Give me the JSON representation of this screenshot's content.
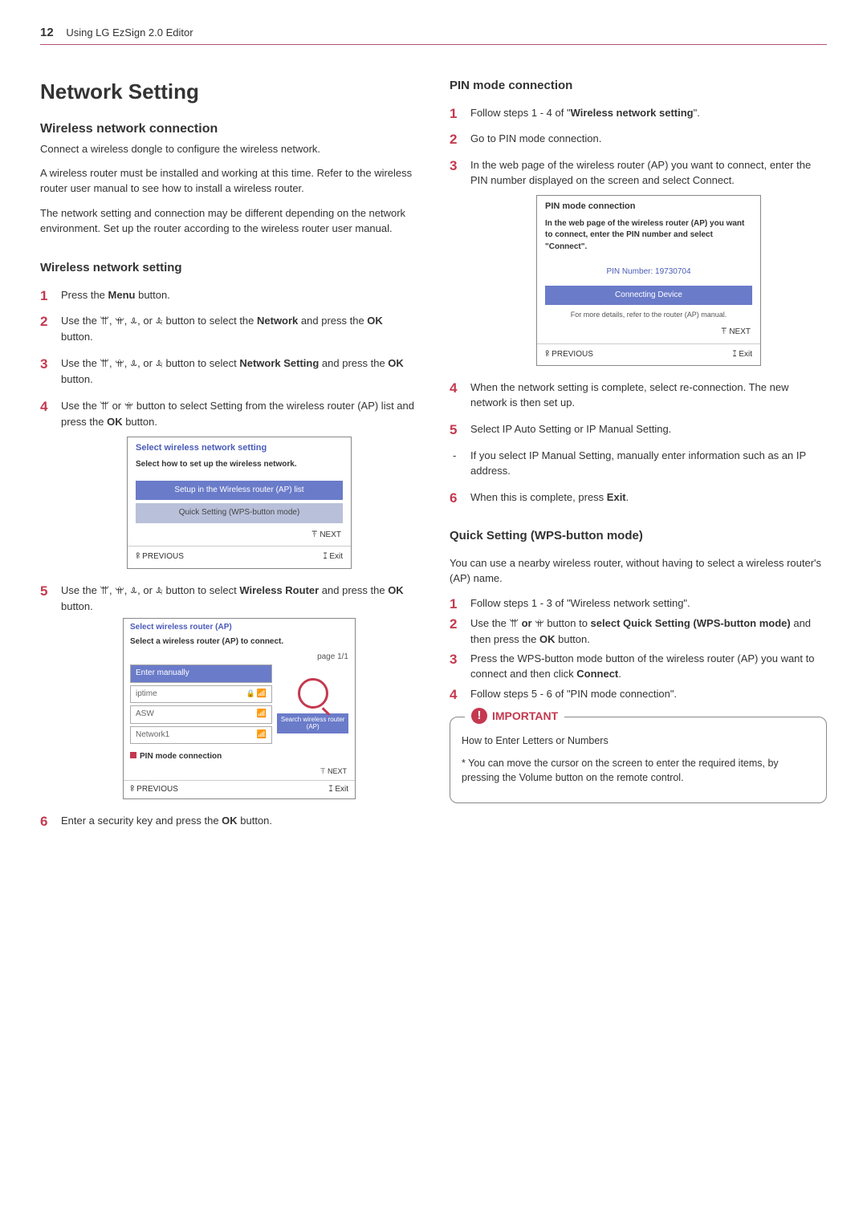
{
  "header": {
    "page_number": "12",
    "section": "Using LG EzSign 2.0 Editor"
  },
  "left": {
    "h1": "Network Setting",
    "h2_wnc": "Wireless network connection",
    "wnc_p1": "Connect a wireless dongle to configure the wireless network.",
    "wnc_p2": "A wireless router must be installed and working at this time. Refer to the wireless router user manual to see how to install a wireless router.",
    "wnc_p3": "The network setting and connection may be different depending on the network environment. Set up the router according to the wireless router user manual.",
    "h3_wns": "Wireless network setting",
    "steps": {
      "s1_a": "Press the ",
      "s1_b": "Menu",
      "s1_c": " button.",
      "s2_a": "Use the ",
      "s2_b": " button to select the ",
      "s2_c": "Network",
      "s2_d": " and press the ",
      "s2_e": "OK",
      "s2_f": " button.",
      "s3_a": "Use the ",
      "s3_b": " button to select ",
      "s3_c": "Network Setting",
      "s3_d": " and press the ",
      "s3_e": "OK",
      "s3_f": " button.",
      "s4_a": "Use the ",
      "s4_b": " button to select Setting from the wireless router (AP) list and press the ",
      "s4_c": "OK",
      "s4_d": " button.",
      "s5_a": "Use the ",
      "s5_b": " button to select ",
      "s5_c": "Wireless Router",
      "s5_d": " and press the ",
      "s5_e": "OK",
      "s5_f": " button.",
      "s6_a": "Enter a security key and press the ",
      "s6_b": "OK",
      "s6_c": " button."
    },
    "dlg1": {
      "title": "Select wireless network setting",
      "desc": "Select how to set up the wireless network.",
      "row1": "Setup in the Wireless router (AP) list",
      "row2": "Quick Setting (WPS-button mode)",
      "next": "ꔉ NEXT",
      "prev": "ꕉ PREVIOUS",
      "exit": "ꕯ Exit"
    },
    "dlg2": {
      "title": "Select wireless router (AP)",
      "sub": "Select a wireless router (AP) to connect.",
      "page": "page 1/1",
      "r_manual": "Enter manually",
      "r_iptime": "iptime",
      "r_asw": "ASW",
      "r_net1": "Network1",
      "search": "Search wireless router (AP)",
      "pin_mode": "PIN mode connection",
      "next": "ꔉ NEXT",
      "prev": "ꕉ PREVIOUS",
      "exit": "ꕯ Exit"
    }
  },
  "right": {
    "h3_pin": "PIN mode connection",
    "pin": {
      "s1_a": "Follow steps 1 - 4 of \"",
      "s1_b": "Wireless network setting",
      "s1_c": "\".",
      "s2": "Go to PIN mode connection.",
      "s3": "In the web page of the wireless router (AP) you want to connect, enter the PIN number displayed on the screen and select Connect.",
      "s4": "When the network setting is complete, select re-connection. The new network is then set up.",
      "s5": "Select IP Auto Setting or IP Manual Setting.",
      "dash": "If you select IP Manual Setting, manually enter information such as an IP address.",
      "s6_a": "When this is complete, press ",
      "s6_b": "Exit",
      "s6_c": "."
    },
    "dlg3": {
      "title": "PIN mode connection",
      "desc": "In the web page of the wireless router (AP) you want to connect, enter the PIN number and select \"Connect\".",
      "pin_num": "PIN Number: 19730704",
      "connecting": "Connecting Device",
      "note": "For more details, refer to the router (AP) manual.",
      "next": "ꔉ NEXT",
      "prev": "ꕉ PREVIOUS",
      "exit": "ꕯ Exit"
    },
    "h3_quick": "Quick Setting (WPS-button mode)",
    "quick_intro": "You can use a nearby wireless router, without having to select a wireless router's (AP) name.",
    "quick": {
      "s1": "Follow steps 1 - 3 of \"Wireless network setting\".",
      "s2_a": "Use the ",
      "s2_b": " button to ",
      "s2_c": "select Quick Setting (WPS-button mode)",
      "s2_d": " and then press the ",
      "s2_e": "OK",
      "s2_f": " button.",
      "s3_a": "Press the WPS-button mode button of the wireless router (AP) you want to connect and then click ",
      "s3_b": "Connect",
      "s3_c": ".",
      "s4": "Follow steps 5 - 6 of \"PIN mode connection\"."
    },
    "important": {
      "label": "IMPORTANT",
      "line1": "How to Enter Letters or Numbers",
      "bullet": "You can move the cursor on the screen to enter the required items, by pressing the Volume button on the remote control."
    }
  },
  "arrows": {
    "up": "ꕌ",
    "down": "ꕍ",
    "left": "ꕊ",
    "right": "ꕋ",
    "or": " or ",
    "comma": ", "
  }
}
